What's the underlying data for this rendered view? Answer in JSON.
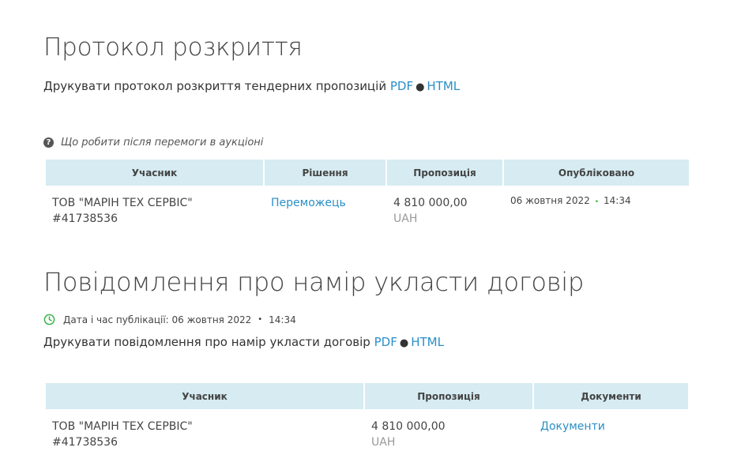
{
  "section1": {
    "title": "Протокол розкриття",
    "print_text": "Друкувати протокол розкриття тендерних пропозицій",
    "pdf_label": "PDF",
    "html_label": "HTML",
    "bullet": "●",
    "help_text": "Що робити після перемоги в аукціоні",
    "help_icon": "question-circle-icon",
    "table": {
      "headers": [
        "Учасник",
        "Рішення",
        "Пропозиція",
        "Опубліковано"
      ],
      "rows": [
        {
          "participant_name": "ТОВ \"МАРІН ТЕХ СЕРВІС\"",
          "participant_id": "#41738536",
          "decision": "Переможець",
          "amount": "4 810 000,00",
          "currency": "UAH",
          "published_date": "06 жовтня 2022",
          "published_dot": "•",
          "published_time": "14:34"
        }
      ]
    }
  },
  "section2": {
    "title": "Повідомлення про намір укласти договір",
    "pub_label": "Дата і час публікації: 06 жовтня 2022",
    "pub_dot": "•",
    "pub_time": "14:34",
    "clock_icon": "clock-icon",
    "print_text": "Друкувати повідомлення про намір укласти договір",
    "pdf_label": "PDF",
    "html_label": "HTML",
    "bullet": "●",
    "table": {
      "headers": [
        "Учасник",
        "Пропозиція",
        "Документи"
      ],
      "rows": [
        {
          "participant_name": "ТОВ \"МАРІН ТЕХ СЕРВІС\"",
          "participant_id": "#41738536",
          "amount": "4 810 000,00",
          "currency": "UAH",
          "documents": "Документи"
        }
      ]
    }
  },
  "colors": {
    "link": "#2a8fc7",
    "header_bg": "#d6ebf2",
    "green": "#3bb54a"
  }
}
